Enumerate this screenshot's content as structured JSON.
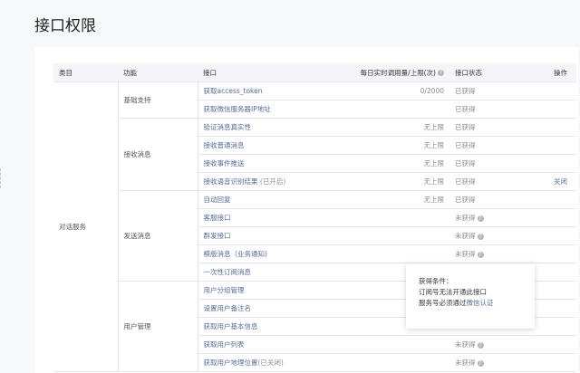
{
  "page": {
    "title": "接口权限"
  },
  "table": {
    "headers": {
      "category": "类目",
      "function": "功能",
      "api": "接口",
      "quota": "每日实时调用量/上限(次)",
      "status": "接口状态",
      "operation": "操作"
    },
    "category_label": "对话服务",
    "groups": {
      "basic": "基础支持",
      "receive": "接收消息",
      "send": "发送消息",
      "user": "用户管理"
    },
    "rows": [
      {
        "api": "获取access_token",
        "quota": "0/2000",
        "status": "已获得"
      },
      {
        "api": "获取微信服务器IP地址",
        "quota": "",
        "status": "已获得"
      },
      {
        "api": "验证消息真实性",
        "quota": "无上限",
        "status": "已获得"
      },
      {
        "api": "接收普通消息",
        "quota": "无上限",
        "status": "已获得"
      },
      {
        "api": "接收事件推送",
        "quota": "无上限",
        "status": "已获得"
      },
      {
        "api": "接收语音识别结果",
        "api_suffix": "(已开启)",
        "quota": "无上限",
        "status": "已获得",
        "op": "关闭"
      },
      {
        "api": "自动回复",
        "quota": "无上限",
        "status": "已获得"
      },
      {
        "api": "客服接口",
        "quota": "",
        "status": "未获得"
      },
      {
        "api": "群发接口",
        "quota": "",
        "status": "未获得"
      },
      {
        "api": "模版消息（业务通知)",
        "quota": "",
        "status": "未获得"
      },
      {
        "api": "一次性订阅消息",
        "quota": "",
        "status": ""
      },
      {
        "api": "用户分组管理",
        "quota": "",
        "status": ""
      },
      {
        "api": "设置用户备注名",
        "quota": "",
        "status": ""
      },
      {
        "api": "获取用户基本信息",
        "quota": "",
        "status": ""
      },
      {
        "api": "获取用户列表",
        "quota": "",
        "status": "未获得"
      },
      {
        "api": "获取用户地理位置",
        "api_suffix": "(已关闭)",
        "quota": "",
        "status": "未获得"
      }
    ]
  },
  "tooltip": {
    "title": "获得条件：",
    "line1": "订阅号无法开通此接口",
    "line2_prefix": "服务号必须通过",
    "line2_link": "微信认证"
  },
  "icons": {
    "help": "question-circle-icon"
  },
  "colors": {
    "link": "#576b95",
    "muted": "#8d8d8d",
    "border": "#e7e7eb",
    "header_bg": "#f4f5f9"
  }
}
